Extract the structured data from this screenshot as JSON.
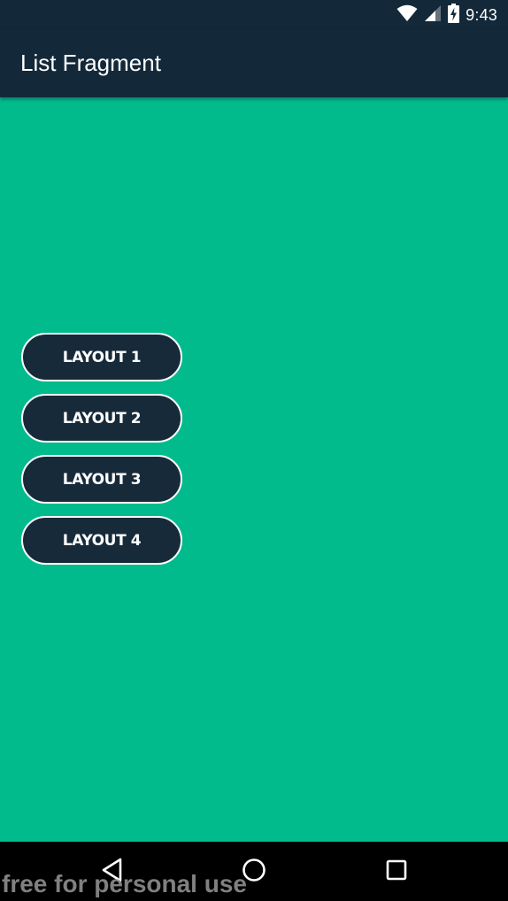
{
  "status_bar": {
    "time": "9:43",
    "icons": [
      "wifi-icon",
      "cellular-signal-icon",
      "battery-charging-icon"
    ]
  },
  "app_bar": {
    "title": "List Fragment"
  },
  "buttons": [
    {
      "label": "LAYOUT 1"
    },
    {
      "label": "LAYOUT 2"
    },
    {
      "label": "LAYOUT 3"
    },
    {
      "label": "LAYOUT 4"
    }
  ],
  "nav_bar": {
    "icons": [
      "back-icon",
      "home-icon",
      "recents-icon"
    ]
  },
  "watermark": "free for personal use",
  "colors": {
    "app_bar_bg": "#13293a",
    "content_bg": "#02bb8d",
    "button_bg": "#172a3a",
    "button_border": "#ffffff",
    "nav_bar_bg": "#000000"
  }
}
